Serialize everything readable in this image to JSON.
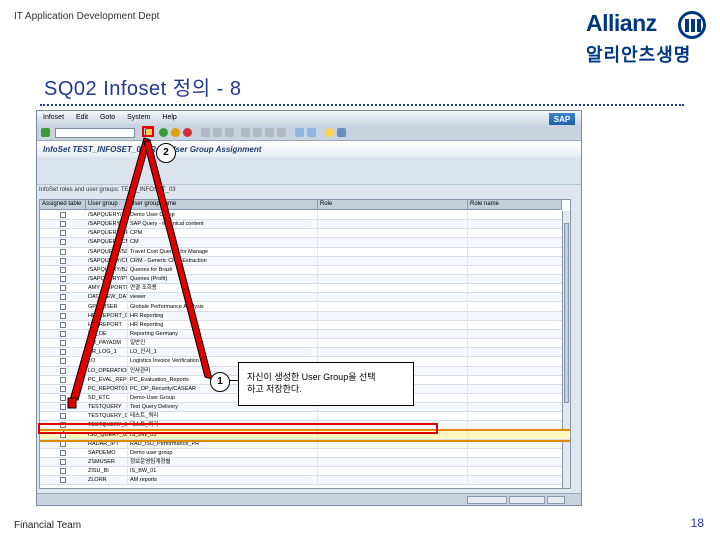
{
  "header": {
    "dept": "IT Application Development Dept",
    "logo_en": "Allianz",
    "logo_ko": "알리안츠생명"
  },
  "slide": {
    "title": "SQ02 Infoset 정의 - 8",
    "footer": "Financial Team",
    "page_number": "18"
  },
  "sap": {
    "menu": [
      "Infoset",
      "Edit",
      "Goto",
      "System",
      "Help"
    ],
    "logo": "SAP",
    "window_title": "InfoSet TEST_INFOSET_03: Role/User Group Assignment",
    "subheader": "InfoSet roles and user groups: TEST_INFOSET_03",
    "columns": [
      "Assigned table",
      "User group",
      "User group name",
      "Role",
      "Role name"
    ],
    "rows": [
      {
        "group": "/SAPQUERY/AM",
        "name": "Demo User Group"
      },
      {
        "group": "/SAPQUERY/B1",
        "name": "SAP Query - technical content"
      },
      {
        "group": "/SAPQUERY/CP",
        "name": "CPM"
      },
      {
        "group": "/SAPQUERY/CM",
        "name": "CM"
      },
      {
        "group": "/SAPQUERY/SD",
        "name": "Travel Cost Queries for Manage"
      },
      {
        "group": "/SAPQUERY/CR",
        "name": "CRM - Generic CRM Extraction"
      },
      {
        "group": "/SAPQUERY/BZ",
        "name": "Queries for Brazil"
      },
      {
        "group": "/SAPQUERY/PY",
        "name": "Queries (Profit)"
      },
      {
        "group": "AMY_REPORT01",
        "name": "연결 조회용"
      },
      {
        "group": "DATAVIEW_DATA",
        "name": "viewer"
      },
      {
        "group": "GPA_USER",
        "name": "Globale Performance Analysis"
      },
      {
        "group": "HR_REPORT_01",
        "name": "HR Reporting"
      },
      {
        "group": "HR_REPORT",
        "name": "HR Reporting"
      },
      {
        "group": "HR_DE",
        "name": "Reporting Germany"
      },
      {
        "group": "HR_PAYADM",
        "name": "일반인"
      },
      {
        "group": "HR_LOG_1",
        "name": "LO_인사_1"
      },
      {
        "group": "LO",
        "name": "Logistics Invoice Verification"
      },
      {
        "group": "LO_OPERATION",
        "name": "인사관리"
      },
      {
        "group": "PC_EVAL_REP",
        "name": "PC_Evaluation_Reports"
      },
      {
        "group": "PC_REPORT01",
        "name": "PC_OP_Recurity/CASEAR"
      },
      {
        "group": "SD_ETC",
        "name": "Demo-User Group"
      },
      {
        "group": "TESTQUERY",
        "name": "Test Query Delivery"
      },
      {
        "group": "TESTQUERY_01",
        "name": "테스트_쿼리"
      },
      {
        "group": "TESTQUERY_02",
        "name": "테스트_쿼리"
      },
      {
        "group": "ISU_QUERY_03",
        "name": "IS_BW_03"
      },
      {
        "group": "RADAR_IPT",
        "name": "RAD_ISU_Performance_PR"
      },
      {
        "group": "SAPDEMO",
        "name": "Demo user group"
      },
      {
        "group": "ZSMUSER",
        "name": "정보운영팀계정별"
      },
      {
        "group": "ZISU_BI",
        "name": "IS_BW_01"
      },
      {
        "group": "ZLORR",
        "name": "AM reports"
      }
    ],
    "selected_row_index": 24
  },
  "annotations": {
    "badge_1": "1",
    "badge_2": "2",
    "callout_text_1": "자신이 생성한 User Group을 선택",
    "callout_text_2": "하고 저장한다."
  },
  "colors": {
    "brand": "#003781",
    "title": "#1f3a93",
    "highlight": "#e00000",
    "selection": "#e08a00"
  }
}
